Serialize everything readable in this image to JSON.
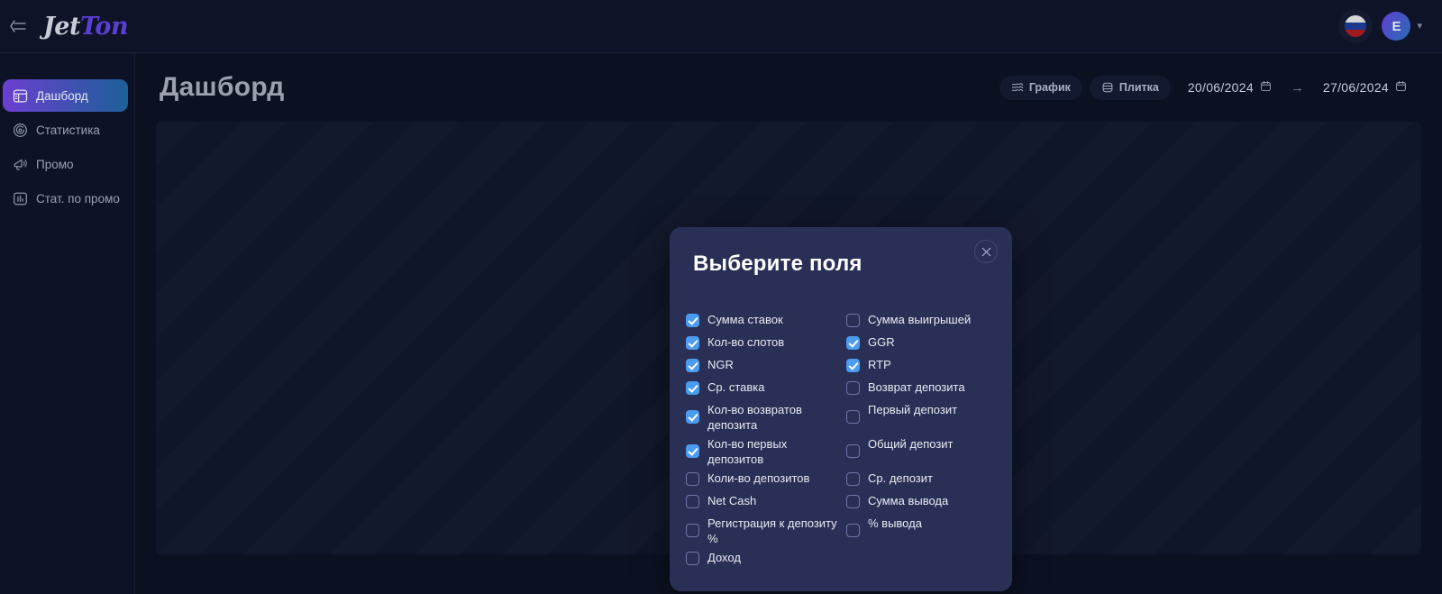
{
  "app": {
    "logo_primary": "Jet",
    "logo_accent": "Ton",
    "collapse_icon": "collapse-left-icon",
    "accent_purple": "#5a3fd6",
    "accent_blue": "#4b9cf0",
    "bg": "#0c1122",
    "modal_bg": "#2a2f55"
  },
  "topbar": {
    "language_flag": "russia-flag-icon",
    "avatar_initial": "E",
    "chevron": "▾"
  },
  "sidebar": {
    "items": [
      {
        "label": "Дашборд",
        "icon": "dashboard-icon",
        "active": true
      },
      {
        "label": "Статистика",
        "icon": "statistics-icon",
        "active": false
      },
      {
        "label": "Промо",
        "icon": "promo-megaphone-icon",
        "active": false
      },
      {
        "label": "Стат. по промо",
        "icon": "bar-chart-icon",
        "active": false
      }
    ]
  },
  "page": {
    "title": "Дашборд",
    "view_buttons": [
      {
        "label": "График",
        "icon": "wave-chart-icon"
      },
      {
        "label": "Плитка",
        "icon": "tile-stack-icon"
      }
    ],
    "date_from": "20/06/2024",
    "date_to": "27/06/2024",
    "date_separator": "→",
    "calendar_icon": "calendar-icon"
  },
  "modal": {
    "title": "Выберите поля",
    "close_icon": "close-icon",
    "columns": [
      {
        "fields": [
          {
            "label": "Сумма ставок",
            "checked": true,
            "two_line": false
          },
          {
            "label": "Кол-во слотов",
            "checked": true,
            "two_line": false
          },
          {
            "label": "NGR",
            "checked": true,
            "two_line": false
          },
          {
            "label": "Ср. ставка",
            "checked": true,
            "two_line": false
          },
          {
            "label": "Кол-во возвратов депозита",
            "checked": true,
            "two_line": true
          },
          {
            "label": "Кол-во первых депозитов",
            "checked": true,
            "two_line": true
          },
          {
            "label": "Коли-во депозитов",
            "checked": false,
            "two_line": false
          },
          {
            "label": "Net Cash",
            "checked": false,
            "two_line": false
          },
          {
            "label": "Регистрация к депозиту %",
            "checked": false,
            "two_line": true
          },
          {
            "label": "Доход",
            "checked": false,
            "two_line": false
          }
        ]
      },
      {
        "fields": [
          {
            "label": "Сумма выигрышей",
            "checked": false,
            "two_line": false
          },
          {
            "label": "GGR",
            "checked": true,
            "two_line": false
          },
          {
            "label": "RTP",
            "checked": true,
            "two_line": false
          },
          {
            "label": "Возврат депозита",
            "checked": false,
            "two_line": false
          },
          {
            "label": "Первый депозит",
            "checked": false,
            "two_line": true
          },
          {
            "label": "Общий депозит",
            "checked": false,
            "two_line": true
          },
          {
            "label": "Ср. депозит",
            "checked": false,
            "two_line": false
          },
          {
            "label": "Сумма вывода",
            "checked": false,
            "two_line": false
          },
          {
            "label": "% вывода",
            "checked": false,
            "two_line": true
          }
        ]
      }
    ]
  }
}
